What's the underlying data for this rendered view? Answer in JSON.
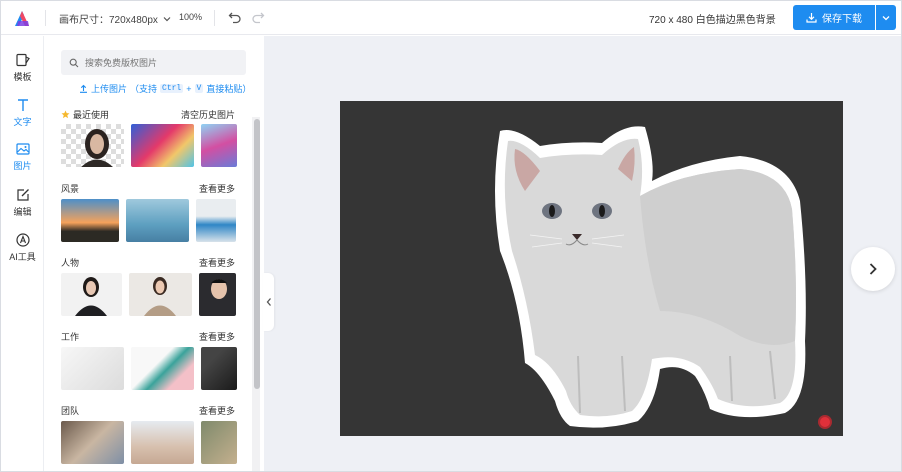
{
  "toolbar": {
    "canvas_size_label": "画布尺寸：720x480px",
    "zoom": "100%",
    "doc_title": "720 x 480 白色描边黑色背景",
    "save_label": "保存下载"
  },
  "rail": {
    "items": [
      {
        "label": "模板",
        "icon": "template-icon"
      },
      {
        "label": "文字",
        "icon": "text-icon"
      },
      {
        "label": "图片",
        "icon": "image-icon",
        "active": true
      },
      {
        "label": "编辑",
        "icon": "edit-icon"
      },
      {
        "label": "AI工具",
        "icon": "ai-tools-icon"
      }
    ]
  },
  "panel": {
    "search_placeholder": "搜索免费版权图片",
    "upload": {
      "link": "上传图片",
      "hint_open": "（支持",
      "key1": "Ctrl",
      "plus": "+",
      "key2": "V",
      "hint_close": "直接粘贴）"
    },
    "sections": [
      {
        "title": "最近使用",
        "action": "清空历史图片"
      },
      {
        "title": "风景",
        "action": "查看更多"
      },
      {
        "title": "人物",
        "action": "查看更多"
      },
      {
        "title": "工作",
        "action": "查看更多"
      },
      {
        "title": "团队",
        "action": "查看更多"
      }
    ]
  },
  "colors": {
    "accent": "#1e8cf0",
    "canvas_bg": "#353535",
    "workspace_bg": "#eef0f5"
  }
}
